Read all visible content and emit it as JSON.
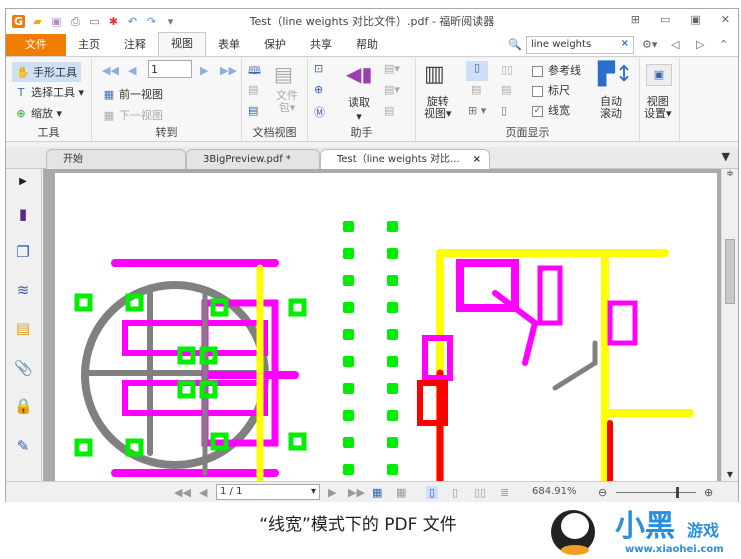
{
  "window": {
    "title": "Test（line weights 对比文件）.pdf - 福昕阅读器"
  },
  "quick_access": [
    "logo-icon",
    "open-icon",
    "save-icon",
    "print-icon",
    "form-icon",
    "new-icon",
    "undo-icon",
    "redo-icon",
    "customize-icon"
  ],
  "menu": {
    "items": [
      "文件",
      "主页",
      "注释",
      "视图",
      "表单",
      "保护",
      "共享",
      "帮助"
    ],
    "active": "视图"
  },
  "search": {
    "value": "line weights",
    "clear": "×"
  },
  "ribbon": {
    "tools": {
      "hand": "手形工具",
      "select": "选择工具",
      "zoom": "缩放",
      "label": "工具"
    },
    "goto": {
      "page": "1",
      "prev_view": "前一视图",
      "next_view": "下一视图",
      "label": "转到"
    },
    "docview": {
      "package": "文件",
      "package2": "包",
      "label": "文档视图"
    },
    "assistant": {
      "read": "读取",
      "label": "助手"
    },
    "pagedisplay": {
      "rotate": "旋转",
      "rotate2": "视图",
      "guides": "参考线",
      "ruler": "标尺",
      "lineweights": "线宽",
      "guides_checked": false,
      "ruler_checked": false,
      "lineweights_checked": true,
      "autoscroll": "自动",
      "autoscroll2": "滚动",
      "label": "页面显示"
    },
    "viewsettings": {
      "line1": "视图",
      "line2": "设置"
    }
  },
  "tabs": [
    {
      "label": "开始"
    },
    {
      "label": "3BigPreview.pdf *"
    },
    {
      "label": "Test（line weights 对比...",
      "active": true
    }
  ],
  "status": {
    "page": "1 / 1",
    "zoom": "684.91%"
  },
  "caption": "“线宽”模式下的 PDF 文件",
  "watermark": {
    "text": "小黑游戏",
    "url": "www.xiaohei.com"
  },
  "colors": {
    "accent": "#f07c00",
    "magenta": "#ff00ff",
    "yellow": "#ffff00",
    "green": "#00ee00",
    "red": "#ff0000",
    "gray": "#808080"
  }
}
